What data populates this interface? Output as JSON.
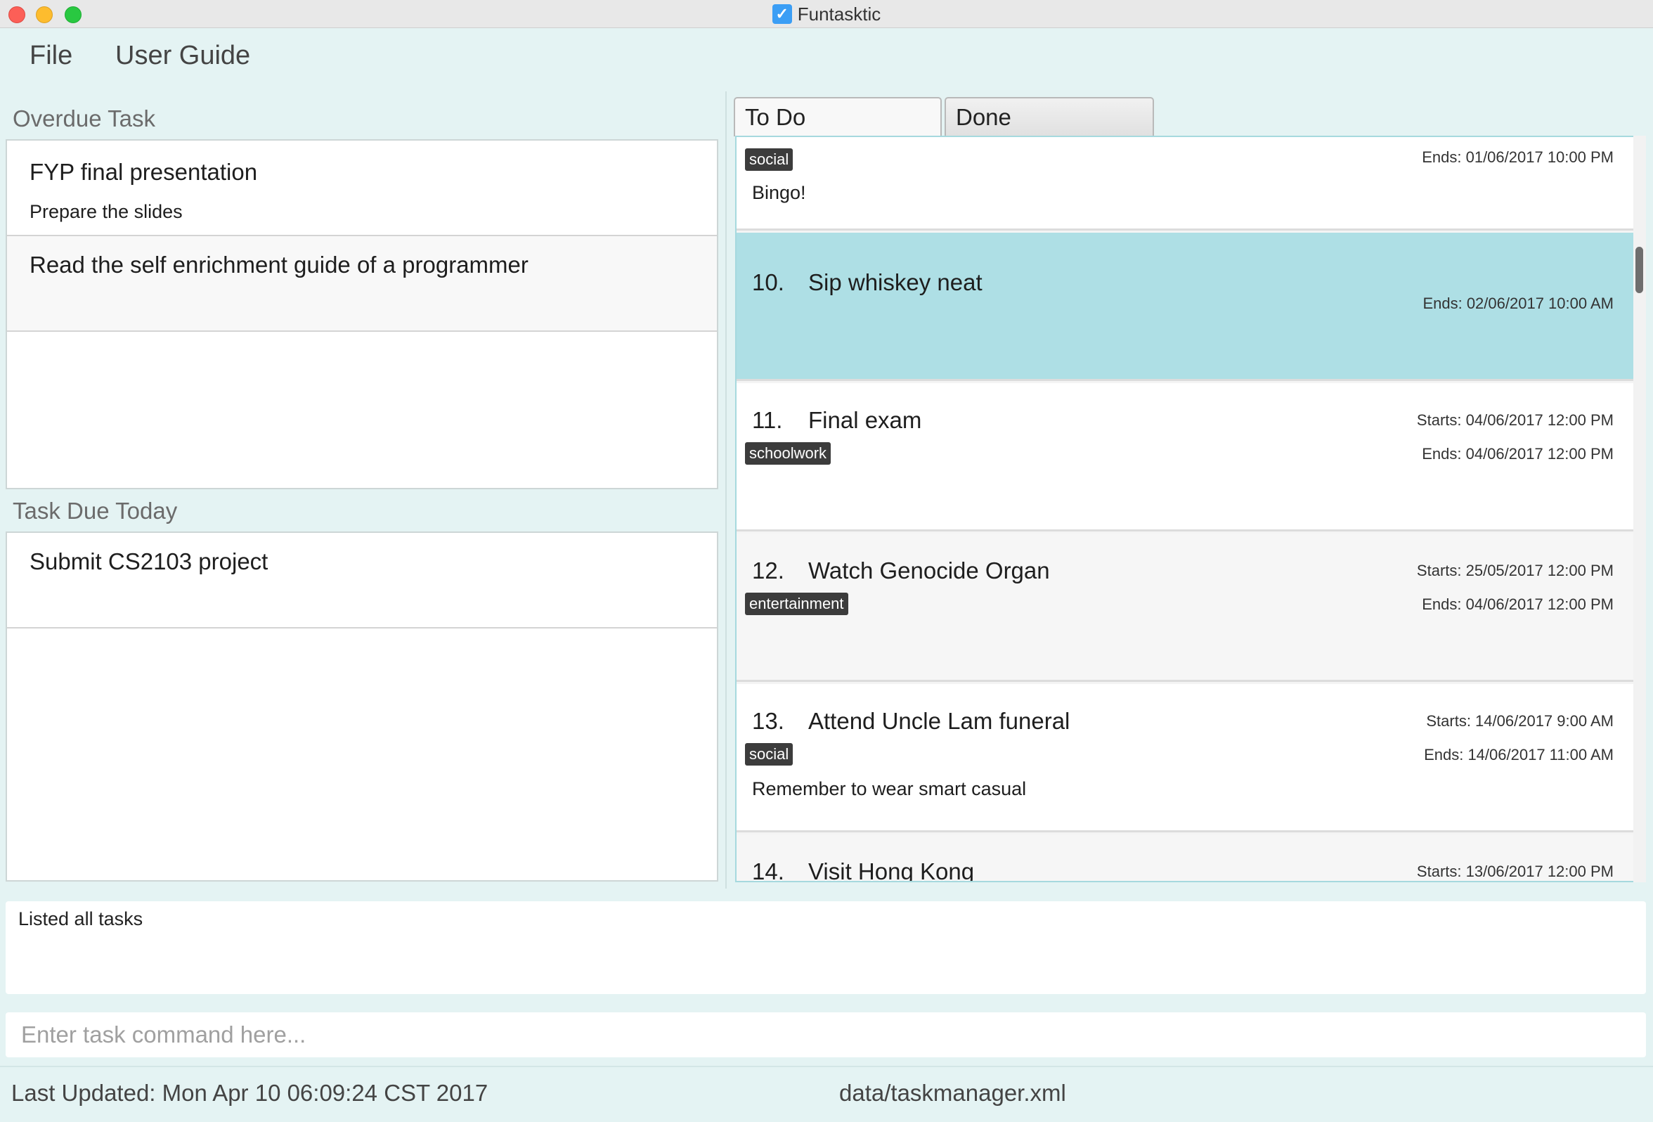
{
  "window": {
    "title": "Funtasktic",
    "icon": "checkbox-icon",
    "check_glyph": "✓"
  },
  "menu": {
    "items": [
      "File",
      "User Guide"
    ]
  },
  "overdue": {
    "label": "Overdue Task",
    "tasks": [
      {
        "name": "FYP final presentation",
        "description": "Prepare the slides"
      },
      {
        "name": "Read the self enrichment guide of a programmer",
        "description": ""
      }
    ]
  },
  "due_today": {
    "label": "Task Due Today",
    "tasks": [
      {
        "name": "Submit CS2103 project"
      }
    ]
  },
  "tabs": [
    "To Do",
    "Done"
  ],
  "task_list": {
    "partial_top": {
      "tag": "social",
      "description": "Bingo!",
      "ends": "Ends: 01/06/2017 10:00 PM"
    },
    "items": [
      {
        "index": "10.",
        "name": "Sip whiskey neat",
        "tag": "",
        "starts": "",
        "ends": "Ends: 02/06/2017 10:00 AM",
        "description": "",
        "selected": true
      },
      {
        "index": "11.",
        "name": "Final exam",
        "tag": "schoolwork",
        "starts": "Starts: 04/06/2017 12:00 PM",
        "ends": "Ends: 04/06/2017 12:00 PM",
        "description": ""
      },
      {
        "index": "12.",
        "name": "Watch Genocide Organ",
        "tag": "entertainment",
        "starts": "Starts: 25/05/2017 12:00 PM",
        "ends": "Ends: 04/06/2017 12:00 PM",
        "description": ""
      },
      {
        "index": "13.",
        "name": "Attend Uncle Lam funeral",
        "tag": "social",
        "starts": "Starts: 14/06/2017 9:00 AM",
        "ends": "Ends: 14/06/2017 11:00 AM",
        "description": "Remember to wear smart casual"
      },
      {
        "index": "14.",
        "name": "Visit Hong Kong",
        "tag": "",
        "starts": "Starts: 13/06/2017 12:00 PM",
        "ends": "",
        "description": ""
      }
    ]
  },
  "result": {
    "text": "Listed all tasks"
  },
  "command": {
    "placeholder": "Enter task command here...",
    "value": ""
  },
  "status": {
    "last_updated": "Last Updated: Mon Apr 10 06:09:24 CST 2017",
    "file": "data/taskmanager.xml"
  },
  "colors": {
    "background": "#e4f3f3",
    "selected_row": "#aedfe5",
    "tag_bg": "#3c3c3c"
  }
}
